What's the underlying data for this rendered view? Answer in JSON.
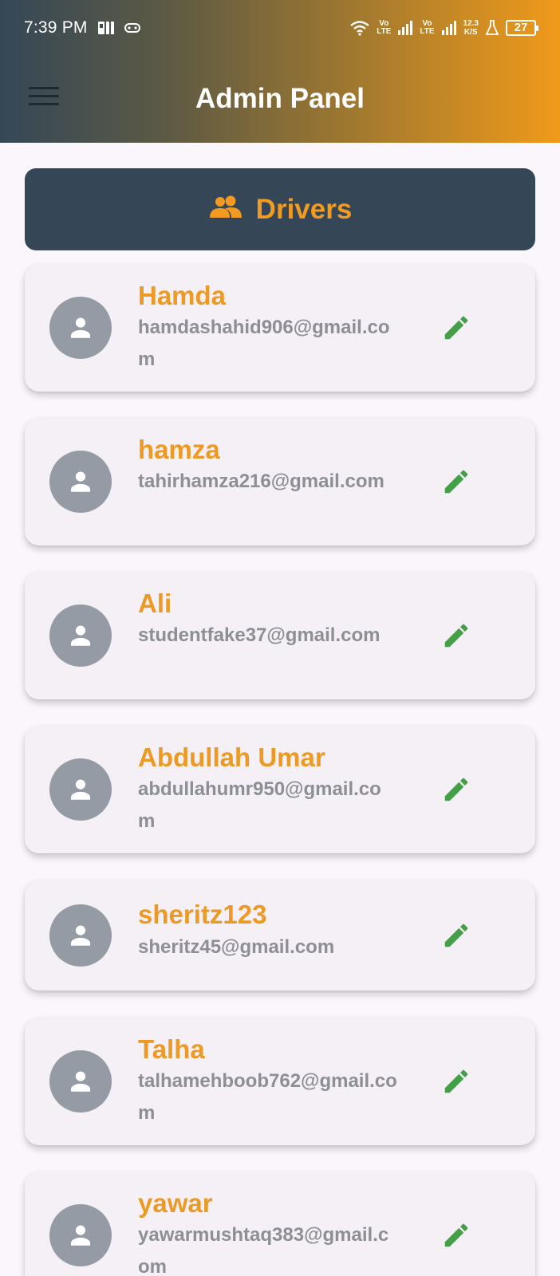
{
  "status_bar": {
    "time": "7:39 PM",
    "lte1_top": "Vo",
    "lte1_bottom": "LTE",
    "lte2_top": "Vo",
    "lte2_bottom": "LTE",
    "speed_top": "12.3",
    "speed_bottom": "K/S",
    "battery": "27"
  },
  "header": {
    "title": "Admin Panel",
    "menu_icon": "hamburger-menu-icon"
  },
  "section": {
    "label": "Drivers",
    "icon": "people-icon"
  },
  "drivers": [
    {
      "name": "Hamda",
      "email": "hamdashahid906@gmail.com"
    },
    {
      "name": "hamza",
      "email": "tahirhamza216@gmail.com"
    },
    {
      "name": "Ali",
      "email": "studentfake37@gmail.com"
    },
    {
      "name": "Abdullah Umar",
      "email": "abdullahumr950@gmail.com"
    },
    {
      "name": "sheritz123",
      "email": "sheritz45@gmail.com"
    },
    {
      "name": "Talha",
      "email": "talhamehboob762@gmail.com"
    },
    {
      "name": "yawar",
      "email": "yawarmushtaq383@gmail.com"
    }
  ],
  "colors": {
    "header_gradient_start": "#354757",
    "header_gradient_end": "#f09a1a",
    "accent_orange": "#ec9a23",
    "banner_bg": "#354757",
    "edit_green": "#43a047",
    "avatar_gray": "#949ba4"
  }
}
